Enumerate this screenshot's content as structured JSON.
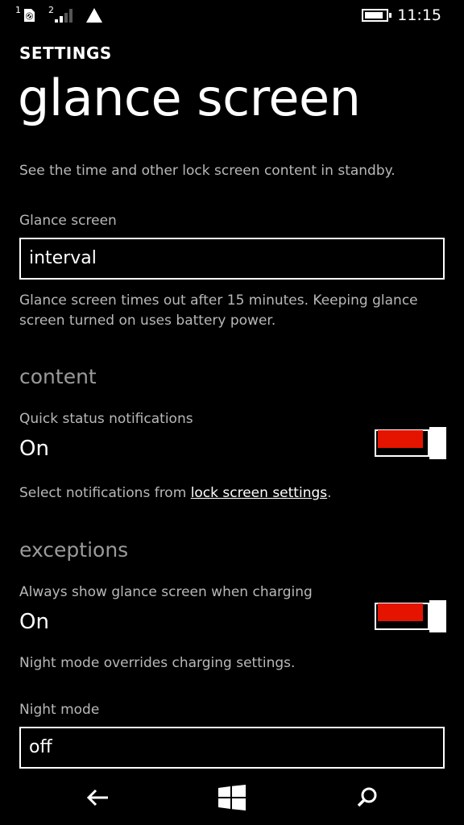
{
  "status_bar": {
    "sim1_marker": "1",
    "sim2_marker": "2",
    "time": "11:15",
    "icons": [
      "no-sim-icon",
      "signal-icon",
      "triangle-signal-icon",
      "battery-icon"
    ],
    "battery_level": 0.85
  },
  "header": {
    "section": "SETTINGS",
    "title": "glance screen"
  },
  "intro": "See the time and other lock screen content in standby.",
  "glance_screen": {
    "label": "Glance screen",
    "value": "interval",
    "note": "Glance screen times out after 15 minutes. Keeping glance screen turned on uses battery power."
  },
  "content_section": {
    "title": "content",
    "quick_status": {
      "label": "Quick status notifications",
      "value": "On",
      "enabled": true
    },
    "note_prefix": "Select notifications from ",
    "note_link": "lock screen settings",
    "note_suffix": "."
  },
  "exceptions_section": {
    "title": "exceptions",
    "charging": {
      "label": "Always show glance screen when charging",
      "value": "On",
      "enabled": true
    },
    "note": "Night mode overrides charging settings."
  },
  "night_mode": {
    "label": "Night mode",
    "value": "off"
  },
  "colors": {
    "accent": "#e51400",
    "background": "#000000",
    "foreground": "#ffffff",
    "muted": "#b8b8b8"
  },
  "nav": {
    "icons": [
      "back-arrow-icon",
      "windows-logo-icon",
      "search-icon"
    ]
  }
}
